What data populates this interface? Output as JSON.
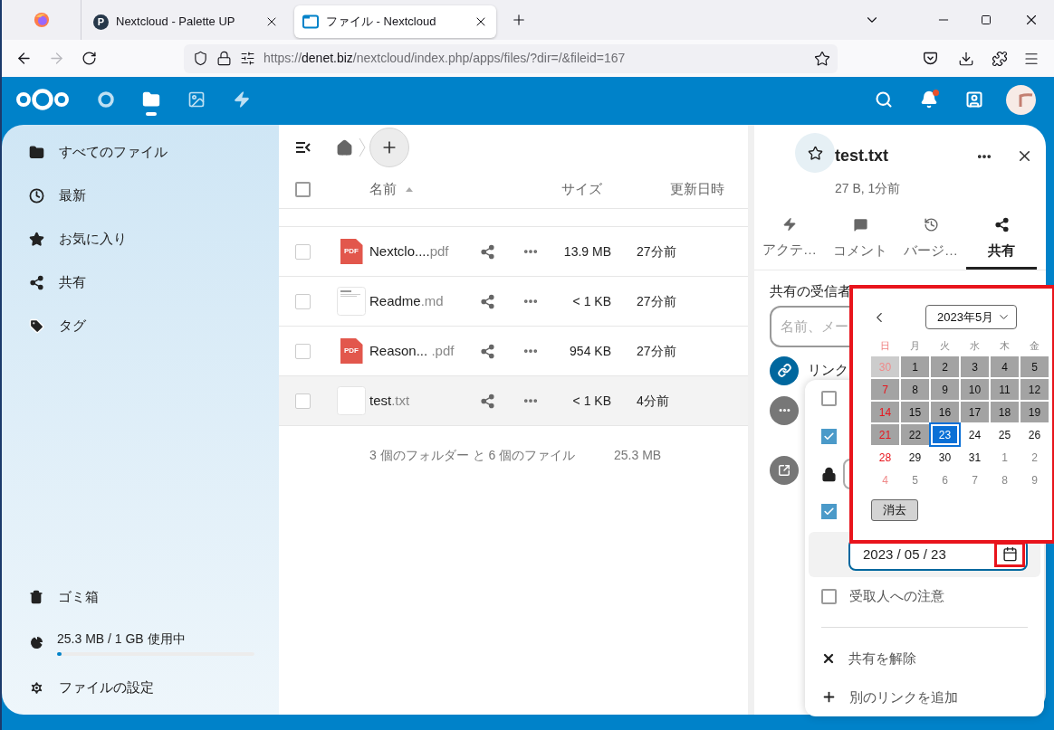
{
  "browser": {
    "tabs": [
      {
        "kind": "firefox",
        "selected": false
      },
      {
        "kind": "site",
        "icon_text": "P",
        "title": "Nextcloud - Palette UP",
        "selected": false
      },
      {
        "kind": "folder",
        "title": "ファイル - Nextcloud",
        "selected": true
      }
    ],
    "url": {
      "scheme": "https://",
      "domain": "denet.biz",
      "path": "/nextcloud/index.php/apps/files/?dir=/&fileid=167"
    }
  },
  "header": {
    "apps": [
      {
        "kind": "dashboard",
        "selected": false
      },
      {
        "kind": "files",
        "selected": true
      },
      {
        "kind": "photos",
        "selected": false
      },
      {
        "kind": "activity",
        "selected": false
      }
    ],
    "notifications_unread": true
  },
  "sidebar": {
    "items": [
      {
        "kind": "folder",
        "label": "すべてのファイル"
      },
      {
        "kind": "recent",
        "label": "最新"
      },
      {
        "kind": "star",
        "label": "お気に入り"
      },
      {
        "kind": "share",
        "label": "共有"
      },
      {
        "kind": "tag",
        "label": "タグ"
      }
    ],
    "trash": "ゴミ箱",
    "quota": {
      "label": "25.3 MB / 1 GB 使用中",
      "level": 0.025
    },
    "settings": "ファイルの設定"
  },
  "files": {
    "select_all_checked": false,
    "columns": {
      "name": "名前",
      "size": "サイズ",
      "modified": "更新日時"
    },
    "rows": [
      {
        "kind": "pdf",
        "icon_text": "PDF",
        "base": "Nextclo....",
        "ext": "pdf",
        "size": "13.9 MB",
        "modified": "27分前",
        "selected": false
      },
      {
        "kind": "doc",
        "base": "Readme",
        "ext": ".md",
        "size": "< 1 KB",
        "modified": "27分前",
        "selected": false
      },
      {
        "kind": "pdf",
        "icon_text": "PDF",
        "base": "Reason...",
        "ext": " .pdf",
        "size": "954 KB",
        "modified": "27分前",
        "selected": false
      },
      {
        "kind": "text",
        "base": "test",
        "ext": ".txt",
        "size": "< 1 KB",
        "modified": "4分前",
        "selected": true
      }
    ],
    "summary": "3 個のフォルダー と 6 個のファイル",
    "total": "25.3 MB"
  },
  "details": {
    "title": "test.txt",
    "subtitle": "27 B, 1分前",
    "tabs": [
      {
        "kind": "activity",
        "label": "アクテ…",
        "selected": false
      },
      {
        "kind": "comments",
        "label": "コメント",
        "selected": false
      },
      {
        "kind": "versions",
        "label": "バージ…",
        "selected": false
      },
      {
        "kind": "sharing",
        "label": "共有",
        "selected": true
      }
    ],
    "share_label": "共有の受信者",
    "search_placeholder": "名前、メー",
    "link_label": "リンク"
  },
  "menu": {
    "items": [
      {
        "kind": "checkbox",
        "checked": false
      },
      {
        "kind": "checkbox",
        "checked": true
      },
      {
        "kind": "password"
      },
      {
        "kind": "checkbox",
        "checked": true
      },
      {
        "kind": "date",
        "value": "2023 / 05 / 23"
      },
      {
        "kind": "checkbox",
        "checked": false,
        "label": "受取人への注意"
      },
      {
        "kind": "divider"
      },
      {
        "kind": "unshare",
        "label": "共有を解除"
      },
      {
        "kind": "add_link",
        "label": "別のリンクを追加"
      }
    ]
  },
  "calendar": {
    "month": "2023年5月",
    "weekdays": [
      "日",
      "月",
      "火",
      "水",
      "木",
      "金"
    ],
    "weeks": [
      [
        {
          "d": "30",
          "disabled": true,
          "outside": true,
          "selected": false
        },
        {
          "d": "1",
          "disabled": true,
          "outside": false,
          "selected": false
        },
        {
          "d": "2",
          "disabled": true,
          "outside": false,
          "selected": false
        },
        {
          "d": "3",
          "disabled": true,
          "outside": false,
          "selected": false
        },
        {
          "d": "4",
          "disabled": true,
          "outside": false,
          "selected": false
        },
        {
          "d": "5",
          "disabled": true,
          "outside": false,
          "selected": false
        }
      ],
      [
        {
          "d": "7",
          "disabled": true,
          "outside": false,
          "selected": false
        },
        {
          "d": "8",
          "disabled": true,
          "outside": false,
          "selected": false
        },
        {
          "d": "9",
          "disabled": true,
          "outside": false,
          "selected": false
        },
        {
          "d": "10",
          "disabled": true,
          "outside": false,
          "selected": false
        },
        {
          "d": "11",
          "disabled": true,
          "outside": false,
          "selected": false
        },
        {
          "d": "12",
          "disabled": true,
          "outside": false,
          "selected": false
        }
      ],
      [
        {
          "d": "14",
          "disabled": true,
          "outside": false,
          "selected": false
        },
        {
          "d": "15",
          "disabled": true,
          "outside": false,
          "selected": false
        },
        {
          "d": "16",
          "disabled": true,
          "outside": false,
          "selected": false
        },
        {
          "d": "17",
          "disabled": true,
          "outside": false,
          "selected": false
        },
        {
          "d": "18",
          "disabled": true,
          "outside": false,
          "selected": false
        },
        {
          "d": "19",
          "disabled": true,
          "outside": false,
          "selected": false
        }
      ],
      [
        {
          "d": "21",
          "disabled": true,
          "outside": false,
          "selected": false
        },
        {
          "d": "22",
          "disabled": true,
          "outside": false,
          "selected": false
        },
        {
          "d": "23",
          "disabled": false,
          "outside": false,
          "selected": true
        },
        {
          "d": "24",
          "disabled": false,
          "outside": false,
          "selected": false
        },
        {
          "d": "25",
          "disabled": false,
          "outside": false,
          "selected": false
        },
        {
          "d": "26",
          "disabled": false,
          "outside": false,
          "selected": false
        }
      ],
      [
        {
          "d": "28",
          "disabled": false,
          "outside": false,
          "selected": false
        },
        {
          "d": "29",
          "disabled": false,
          "outside": false,
          "selected": false
        },
        {
          "d": "30",
          "disabled": false,
          "outside": false,
          "selected": false
        },
        {
          "d": "31",
          "disabled": false,
          "outside": false,
          "selected": false
        },
        {
          "d": "1",
          "disabled": false,
          "outside": true,
          "selected": false
        },
        {
          "d": "2",
          "disabled": false,
          "outside": true,
          "selected": false
        }
      ],
      [
        {
          "d": "4",
          "disabled": false,
          "outside": true,
          "selected": false
        },
        {
          "d": "5",
          "disabled": false,
          "outside": true,
          "selected": false
        },
        {
          "d": "6",
          "disabled": false,
          "outside": true,
          "selected": false
        },
        {
          "d": "7",
          "disabled": false,
          "outside": true,
          "selected": false
        },
        {
          "d": "8",
          "disabled": false,
          "outside": true,
          "selected": false
        },
        {
          "d": "9",
          "disabled": false,
          "outside": true,
          "selected": false
        }
      ]
    ],
    "clear": "消去"
  }
}
